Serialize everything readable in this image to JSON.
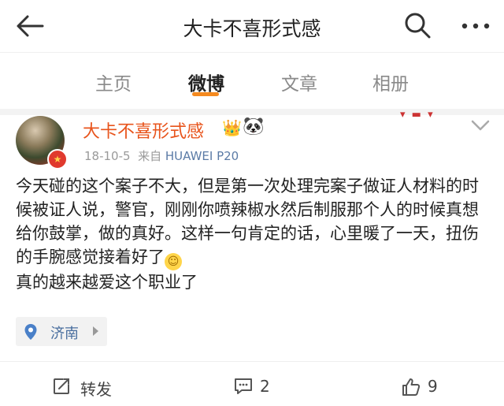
{
  "header": {
    "title": "大卡不喜形式感",
    "back_icon": "back-arrow-icon",
    "search_icon": "search-icon",
    "more_icon": "more-dots-icon"
  },
  "tabs": [
    {
      "label": "主页",
      "active": false
    },
    {
      "label": "微博",
      "active": true
    },
    {
      "label": "文章",
      "active": false
    },
    {
      "label": "相册",
      "active": false
    }
  ],
  "post": {
    "username": "大卡不喜形式感",
    "date": "18-10-5",
    "source_prefix": "来自",
    "source": "HUAWEI P20",
    "text": "今天碰的这个案子不大，但是第一次处理完案子做证人材料的时候被证人说，警官，刚刚你喷辣椒水然后制服那个人的时候真想给你鼓掌，做的真好。这样一句肯定的话，心里暖了一天，扭伤的手腕感觉接着好了",
    "text_line2": "真的越来越爱这个职业了",
    "location": "济南"
  },
  "actions": {
    "repost_label": "转发",
    "comment_count": "2",
    "like_count": "9"
  },
  "colors": {
    "accent": "#f58a1f",
    "username": "#e8541c",
    "link": "#5b7ba6"
  }
}
